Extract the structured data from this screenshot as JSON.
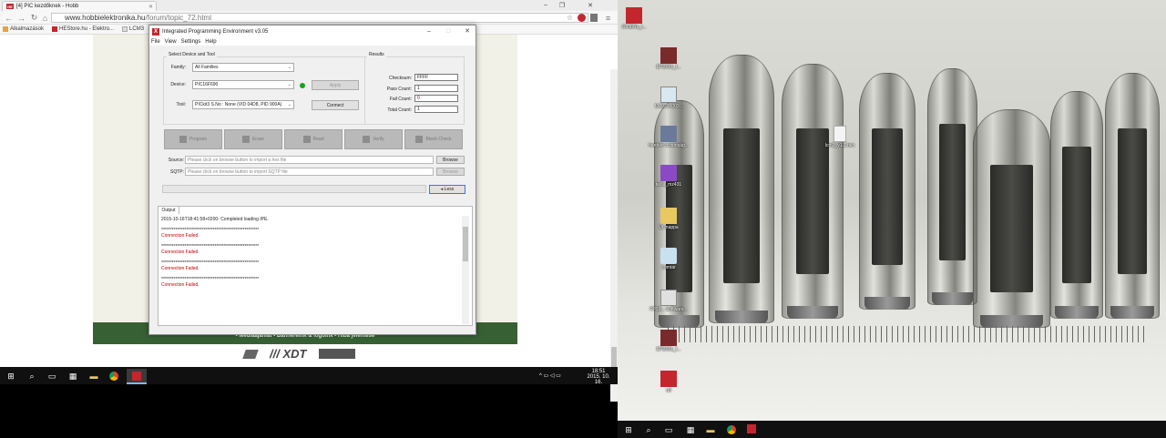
{
  "browser": {
    "tab_title": "[4] PIC kezdőknek - Hobb",
    "tab_favicon": "HE",
    "url_host": "www.hobbielektronika.hu",
    "url_path": "/forum/topic_72.html",
    "bookmarks": [
      {
        "label": "Alkalmazások",
        "icon": "apps-icon",
        "color": "#e8a33a"
      },
      {
        "label": "HEStore.hu - Elektro...",
        "icon": "hestore-icon",
        "color": "#c4262e"
      },
      {
        "label": "LCM3",
        "icon": "page-icon",
        "color": "#cccccc"
      }
    ]
  },
  "website": {
    "footer_links": "• Médiaajánlat • Bannereink & logóink • Hiba jelentése",
    "logo_text": "/// XDT"
  },
  "ipe": {
    "title": "Integrated Programming Environment v3.05",
    "logo": "X",
    "menu": [
      "File",
      "View",
      "Settings",
      "Help"
    ],
    "select_group_label": "Select Device and Tool",
    "family_label": "Family:",
    "family_value": "All Families",
    "device_label": "Device:",
    "device_value": "PIC16F690",
    "apply_label": "Apply",
    "tool_label": "Tool:",
    "tool_value": "PICkit3 S.No : None (VID 04D8, PID 900A)",
    "connect_label": "Connect",
    "status_color": "#1aa31a",
    "results_label": "Results",
    "results": [
      {
        "label": "Checksum:",
        "value": "FFFF",
        "color": "#222222"
      },
      {
        "label": "Pass Count:",
        "value": "1",
        "color": "#222222"
      },
      {
        "label": "Fail Count:",
        "value": "0",
        "color": "#c00000"
      },
      {
        "label": "Total Count:",
        "value": "1",
        "color": "#222222"
      }
    ],
    "actions": [
      "Program",
      "Erase",
      "Read",
      "Verify",
      "Blank Check"
    ],
    "source_label": "Source:",
    "source_placeholder": "Please click on browse button to import a hex file",
    "sqtp_label": "SQTP:",
    "sqtp_placeholder": "Please click on browse button to import SQTP file",
    "browse_label": "Browse",
    "less_label": "◂ Less",
    "output_tab": "Output",
    "output_lines": [
      {
        "text": "2015-10-16T18:41:58+0200- Completed loading IPE.",
        "type": "normal"
      },
      {
        "text": "",
        "type": "normal"
      },
      {
        "text": "*******************************************************",
        "type": "normal"
      },
      {
        "text": "Connection Failed.",
        "type": "err"
      },
      {
        "text": "",
        "type": "normal"
      },
      {
        "text": "*******************************************************",
        "type": "normal"
      },
      {
        "text": "Connection Failed.",
        "type": "err"
      },
      {
        "text": "",
        "type": "normal"
      },
      {
        "text": "*******************************************************",
        "type": "normal"
      },
      {
        "text": "Connection Failed.",
        "type": "err"
      },
      {
        "text": "",
        "type": "normal"
      },
      {
        "text": "*******************************************************",
        "type": "normal"
      },
      {
        "text": "Connection Failed.",
        "type": "err"
      }
    ]
  },
  "taskbar_left": {
    "time": "18:51",
    "date": "2015. 10. 16."
  },
  "desktop_icons": [
    {
      "label": "Gh3bNa_l...",
      "color": "#c4262e"
    },
    {
      "label": "EP2X01_f...",
      "color": "#7a2a2a"
    },
    {
      "label": "1130336003...",
      "color": "#d8e8f0"
    },
    {
      "label": "hardver biztonság...",
      "color": "#6a7a9a"
    },
    {
      "label": "tesla_mz431",
      "color": "#8a4ac4"
    },
    {
      "label": "Új mappa",
      "color": "#e8c860"
    },
    {
      "label": "Lomtár",
      "color": "#c8e0f0"
    },
    {
      "label": "FP02... Software...",
      "color": "#e0e0e0"
    },
    {
      "label": "EP2X01_f...",
      "color": "#7a2a2a"
    },
    {
      "label": "ud",
      "color": "#c4262e"
    },
    {
      "label": "lcm3_v1.2.hex",
      "color": "#f4f4f4"
    }
  ],
  "colors": {
    "chrome_bg": "#f7f7f7",
    "site_green": "#376134",
    "taskbar": "#101010",
    "error_red": "#c00000"
  }
}
